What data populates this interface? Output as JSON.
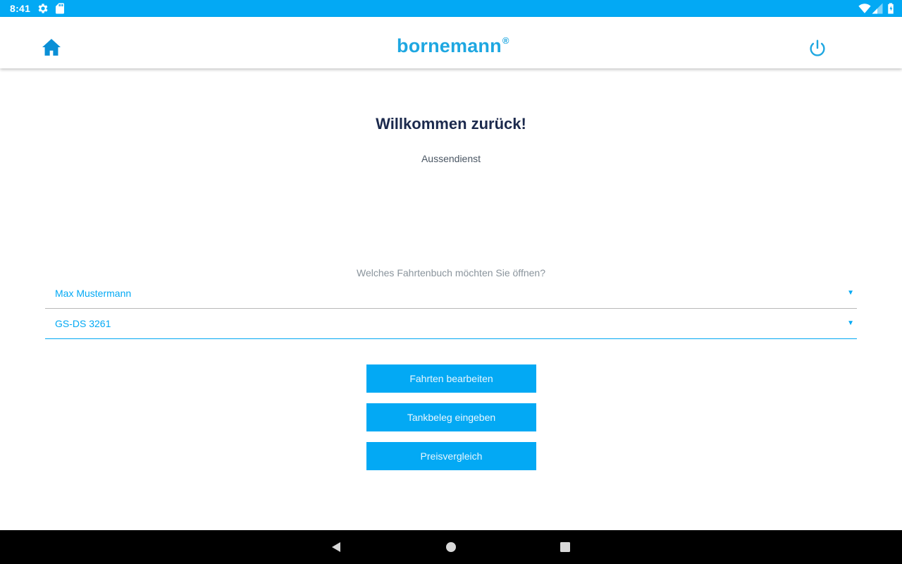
{
  "status_bar": {
    "time": "8:41",
    "icons": [
      "gear-icon",
      "sd-card-icon",
      "wifi-icon",
      "signal-icon",
      "battery-icon"
    ],
    "color": "#03a9f4"
  },
  "app_bar": {
    "logo_text": "bornemann",
    "logo_mark": "®",
    "left_icon": "home-icon",
    "right_icon": "power-icon",
    "accent_color": "#1ea7e1"
  },
  "main": {
    "welcome": "Willkommen zurück!",
    "role": "Aussendienst",
    "question": "Welches Fahrtenbuch möchten Sie öffnen?",
    "driver_select": {
      "value": "Max Mustermann"
    },
    "vehicle_select": {
      "value": "GS-DS 3261"
    },
    "buttons": [
      {
        "label": "Fahrten bearbeiten"
      },
      {
        "label": "Tankbeleg eingeben"
      },
      {
        "label": "Preisvergleich"
      }
    ]
  },
  "nav_bar": {
    "icons": [
      "back-icon",
      "home-nav-icon",
      "recents-icon"
    ]
  }
}
